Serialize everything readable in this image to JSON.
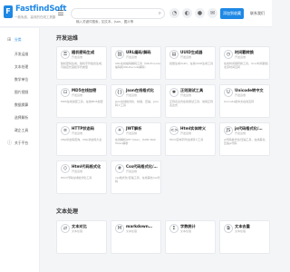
{
  "header": {
    "logo_mark": "F",
    "logo_title": "FastfindSoft",
    "logo_sub": "一款免费、高效的在线工具集",
    "search_placeholder": "输入关键词搜索，如文本、Json、图片等",
    "btn_primary": "添加到收藏",
    "btn_text": "联系我们"
  },
  "sidebar": {
    "items": [
      {
        "label": "分类",
        "icon": "grid-icon"
      },
      {
        "label": "开发运维"
      },
      {
        "label": "文本处理"
      },
      {
        "label": "数学单位"
      },
      {
        "label": "图片视频"
      },
      {
        "label": "数据换算"
      },
      {
        "label": "选择解析"
      },
      {
        "label": "政企工具"
      },
      {
        "label": "关于平台"
      }
    ]
  },
  "sections": [
    {
      "title": "开发运维",
      "cards": [
        {
          "title": "随机密码生成",
          "tag": "开发运维",
          "desc": "随机密码生成，随机字符组合生成，可指定长度和字符类型"
        },
        {
          "title": "URL编码/解码",
          "tag": "开发运维",
          "desc": "URL在线编码解码工具（URLEncode编码和URLDecode解码）"
        },
        {
          "title": "UUID生成器",
          "tag": "开发运维",
          "desc": "批量生成UUID，在线UUID生成工具"
        },
        {
          "title": "时间戳转换",
          "tag": "开发运维",
          "desc": "在线时间戳转换工具，Unix时间戳和北京时间互转"
        },
        {
          "title": "MD5在线加密",
          "tag": "开发运维",
          "desc": "MD5在线加密工具，在线MD5加密"
        },
        {
          "title": "Json在线格式化",
          "tag": "开发运维",
          "desc": "Json在线格式化、校验、压缩，Json转义工具"
        },
        {
          "title": "正则测试工具",
          "tag": "开发运维",
          "desc": "正则表达式在线测试工具，常用正则表达式"
        },
        {
          "title": "Unicode转中文",
          "tag": "开发运维",
          "desc": "Unicode和中文在线互转"
        },
        {
          "title": "HTTP状态码",
          "tag": "开发运维",
          "desc": "http状态码查询，http状态码大全"
        },
        {
          "title": "JWT解析",
          "tag": "开发运维",
          "desc": "在线解析JWT token，JSON Web Token解析"
        },
        {
          "title": "Html实体转义",
          "tag": "开发运维",
          "desc": "Html实体字符在线转义工具"
        },
        {
          "title": "js代码格式化/…",
          "tag": "开发运维",
          "desc": "js代码格式化/压缩工具，在线美化、压缩js代码"
        },
        {
          "title": "Html代码格式化",
          "tag": "开发运维",
          "desc": "Html代码在线格式化工具"
        },
        {
          "title": "Css代码格式化/…",
          "tag": "开发运维",
          "desc": "css格式化/压缩工具，在线美化css代码"
        }
      ]
    },
    {
      "title": "文本处理",
      "cards": [
        {
          "title": "文本对比",
          "tag": "文本处理",
          "desc": ""
        },
        {
          "title": "markdown…",
          "tag": "文本处理",
          "desc": ""
        },
        {
          "title": "字数统计",
          "tag": "文本处理",
          "desc": ""
        },
        {
          "title": "文本去重",
          "tag": "文本处理",
          "desc": ""
        }
      ]
    }
  ]
}
